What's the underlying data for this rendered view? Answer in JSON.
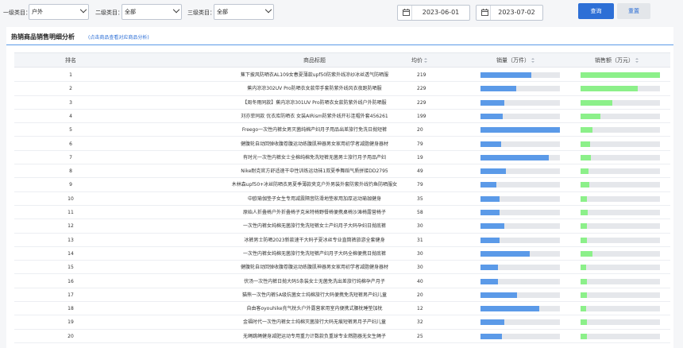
{
  "filters": {
    "cat1_label": "一级类目：",
    "cat1_value": "户外",
    "cat2_label": "二级类目：",
    "cat2_value": "全部",
    "cat3_label": "三级类目：",
    "cat3_value": "全部",
    "date_start": "2023-06-01",
    "date_end": "2023-07-02",
    "query_label": "查询",
    "reset_label": "重置"
  },
  "card": {
    "title": "热销商品销售明细分析",
    "subtitle": "(点击商品查看对应商品分析)"
  },
  "table": {
    "headers": [
      "排名",
      "商品标题",
      "均价",
      "销量（万件）",
      "销售额（万元）"
    ],
    "colors": {
      "sales": "#5b9ae8",
      "revenue": "#8cf08a"
    },
    "rows": [
      {
        "rank": "1",
        "title": "蕉下披风防晒衣AL109女春夏薄款upf50防紫外线凉纱冰丝透气防晒服",
        "price": "219",
        "sales": 0.64,
        "revenue": 1.0
      },
      {
        "rank": "2",
        "title": "蕉内凉凉302UV Pro防晒衣女款带手套防紫外线风衣夜跑防晒服",
        "price": "229",
        "sales": 0.45,
        "revenue": 0.72
      },
      {
        "rank": "3",
        "title": "【周冬雨同款】蕉内凉凉301UV Pro防晒衣女款防紫外线户外防晒服",
        "price": "229",
        "sales": 0.3,
        "revenue": 0.4
      },
      {
        "rank": "4",
        "title": "刘亦菲同款 优衣库防晒衣 女装AIRism防紫外线开衫连帽外套456261",
        "price": "199",
        "sales": 0.28,
        "revenue": 0.25
      },
      {
        "rank": "5",
        "title": "Freego一次性内裤女男灭菌纯棉产妇月子用品出差旅行免洗日抛短裤",
        "price": "20",
        "sales": 1.0,
        "revenue": 0.15
      },
      {
        "rank": "6",
        "title": "健腹轮自动回弹收腹卷腹运动练腹肌神器男女家用初学者减脂健身器材",
        "price": "79",
        "sales": 0.26,
        "revenue": 0.12
      },
      {
        "rank": "7",
        "title": "有时光一次性内裤女士全棉纯棉免洗短裤无菌男士旅行月子用品产妇",
        "price": "19",
        "sales": 0.86,
        "revenue": 0.13
      },
      {
        "rank": "8",
        "title": "Nike耐克官方舒适速干中性训练运动袜1双夏季舞蹈气质拼接DD2795",
        "price": "49",
        "sales": 0.32,
        "revenue": 0.1
      },
      {
        "rank": "9",
        "title": "木林森upf50+冰丝防晒衣男夏季薄款夹克户外男装外套防紫外线钓鱼防晒服女",
        "price": "79",
        "sales": 0.2,
        "revenue": 0.11
      },
      {
        "rank": "10",
        "title": "中欧瑜伽垫子女生专用减震隔音防滑地垫家用加厚运动瑜珈健身",
        "price": "35",
        "sales": 0.24,
        "revenue": 0.08
      },
      {
        "rank": "11",
        "title": "原始人折叠椅户外折叠椅子克米特椅野餐椅便携桌椅沙滩椅露营椅子",
        "price": "58",
        "sales": 0.24,
        "revenue": 0.09
      },
      {
        "rank": "12",
        "title": "一次性内裤女纯棉无菌旅行免洗短裤女士产妇月子大码孕妇日抛底裤",
        "price": "30",
        "sales": 0.3,
        "revenue": 0.08
      },
      {
        "rank": "13",
        "title": "冰裤男士防晒2023新款速干大码子夏冰丝专业直筒裤旅游全套健身",
        "price": "31",
        "sales": 0.24,
        "revenue": 0.08
      },
      {
        "rank": "14",
        "title": "一次性内裤女纯棉无菌旅行免洗短裤产妇月子大码全棉便携日抛底裤",
        "price": "30",
        "sales": 0.62,
        "revenue": 0.15
      },
      {
        "rank": "15",
        "title": "健腹轮自动回弹收腹卷腹运动练腹肌神器男女家用初学者减脂健身器材",
        "price": "30",
        "sales": 0.22,
        "revenue": 0.07
      },
      {
        "rank": "16",
        "title": "伏汤一次性内裤日抛大码5条装女士无菌免洗出差旅行纯棉孕产月子",
        "price": "40",
        "sales": 0.22,
        "revenue": 0.08
      },
      {
        "rank": "17",
        "title": "猫熊一次性内裤5A级抗菌女士纯棉旅行大码便携免洗短裤男产妇儿童",
        "price": "20",
        "sales": 0.46,
        "revenue": 0.08
      },
      {
        "rank": "18",
        "title": "自由客oyouhike充气枕头户外露营家用室内便携式腰枕睡垫加枕",
        "price": "12",
        "sales": 0.74,
        "revenue": 0.07
      },
      {
        "rank": "19",
        "title": "金福时代一次性内裤女士纯棉灭菌旅行大码无痕短裤男月子产妇儿童",
        "price": "32",
        "sales": 0.3,
        "revenue": 0.08
      },
      {
        "rank": "20",
        "title": "无绳跳绳健身减肥运动专用重力计数款负重球专业燃脂器无女生绳子",
        "price": "25",
        "sales": 0.27,
        "revenue": 0.08
      }
    ]
  }
}
